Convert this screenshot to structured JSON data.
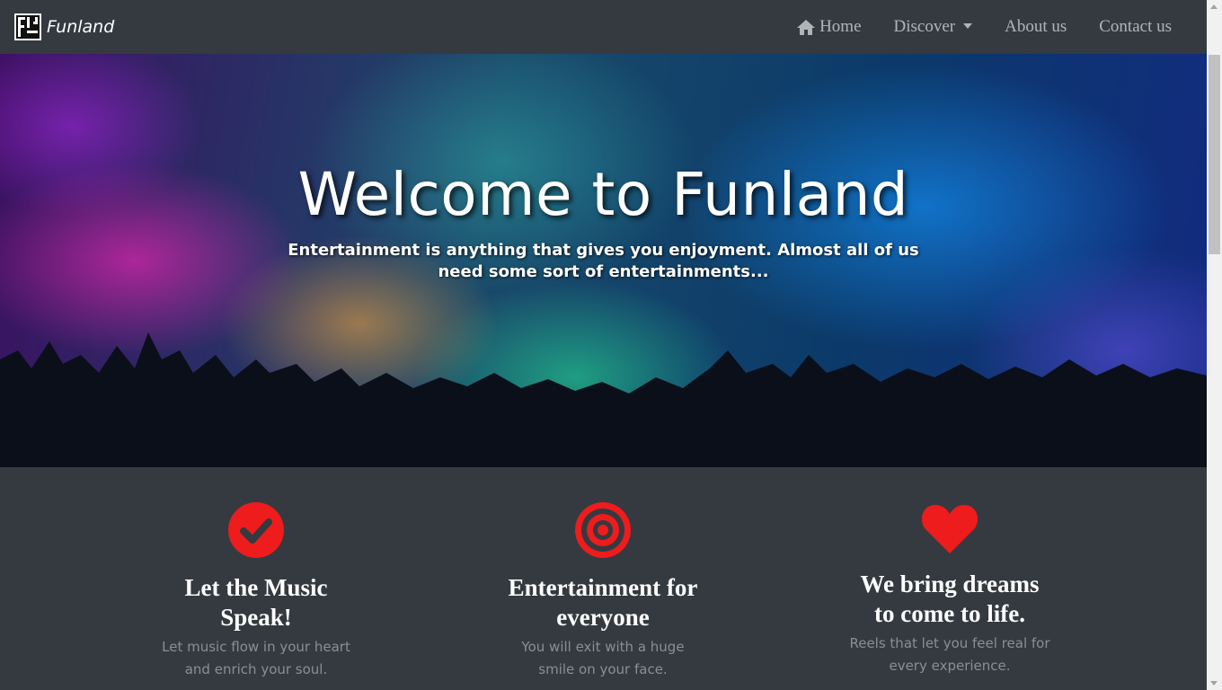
{
  "navbar": {
    "brand_name": "Funland",
    "logo_icon": "funland-logo-icon",
    "items": [
      {
        "label": "Home",
        "icon": "home-icon"
      },
      {
        "label": "Discover",
        "icon": "caret-down-icon"
      },
      {
        "label": "About us"
      },
      {
        "label": "Contact us"
      }
    ]
  },
  "hero": {
    "title": "Welcome to Funland",
    "subtitle": "Entertainment is anything that gives you enjoyment. Almost all of us need some sort of entertainments..."
  },
  "features": [
    {
      "icon": "check-circle-icon",
      "title": "Let the Music Speak!",
      "text": "Let music flow in your heart and enrich your soul."
    },
    {
      "icon": "bullseye-icon",
      "title": "Entertainment for everyone",
      "text": "You will exit with a huge smile on your face."
    },
    {
      "icon": "heart-icon",
      "title": "We bring dreams to come to life.",
      "text": "Reels that let you feel real for every experience."
    }
  ],
  "colors": {
    "navbar_bg": "#343a40",
    "accent_red": "#ee1c1c",
    "nav_text": "rgba(255,255,255,0.62)",
    "feature_text": "#8a8f95"
  }
}
